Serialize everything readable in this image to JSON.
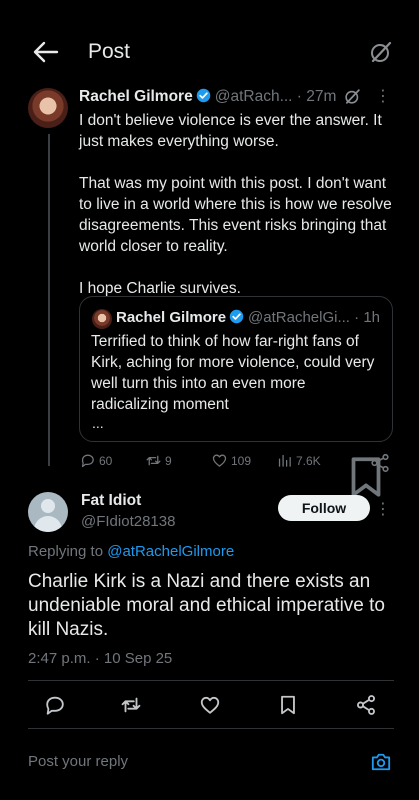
{
  "header": {
    "title": "Post"
  },
  "parent_post": {
    "author_name": "Rachel Gilmore",
    "author_handle": "@atRach...",
    "time": "· 27m",
    "paragraphs": [
      "I don't believe violence is ever the answer. It just makes everything worse.",
      "That was my point with this post. I don't want to live in a world where this is how we resolve disagreements. This event risks bringing that world closer to reality.",
      "I hope Charlie survives."
    ],
    "quote": {
      "author_name": "Rachel Gilmore",
      "author_handle": "@atRachelGi...",
      "time": "· 1h",
      "text": "Terrified to think of how far-right fans of Kirk, aching for more violence, could very well turn this into an even more radicalizing moment",
      "more": "..."
    },
    "stats": {
      "replies": "60",
      "reposts": "9",
      "likes": "109",
      "views": "7.6K"
    }
  },
  "reply_post": {
    "author_name": "Fat Idiot",
    "author_handle": "@FIdiot28138",
    "follow_label": "Follow",
    "replying_prefix": "Replying to ",
    "replying_handle": "@atRachelGilmore",
    "text": "Charlie Kirk is a Nazi and there exists an undeniable moral and ethical imperative to kill Nazis.",
    "timestamp": "2:47 p.m. · 10 Sep 25"
  },
  "composer": {
    "placeholder": "Post your reply"
  },
  "colors": {
    "background": "#000000",
    "accent": "#1d9bf0",
    "text": "#e7e9ea",
    "muted": "#71767b",
    "verified": "#1d9bf0"
  },
  "icons": [
    "back-arrow-icon",
    "grok-slash-icon",
    "verified-badge-icon",
    "more-dots-icon",
    "reply-icon",
    "repost-icon",
    "like-icon",
    "views-icon",
    "bookmark-icon",
    "share-icon",
    "camera-icon"
  ]
}
